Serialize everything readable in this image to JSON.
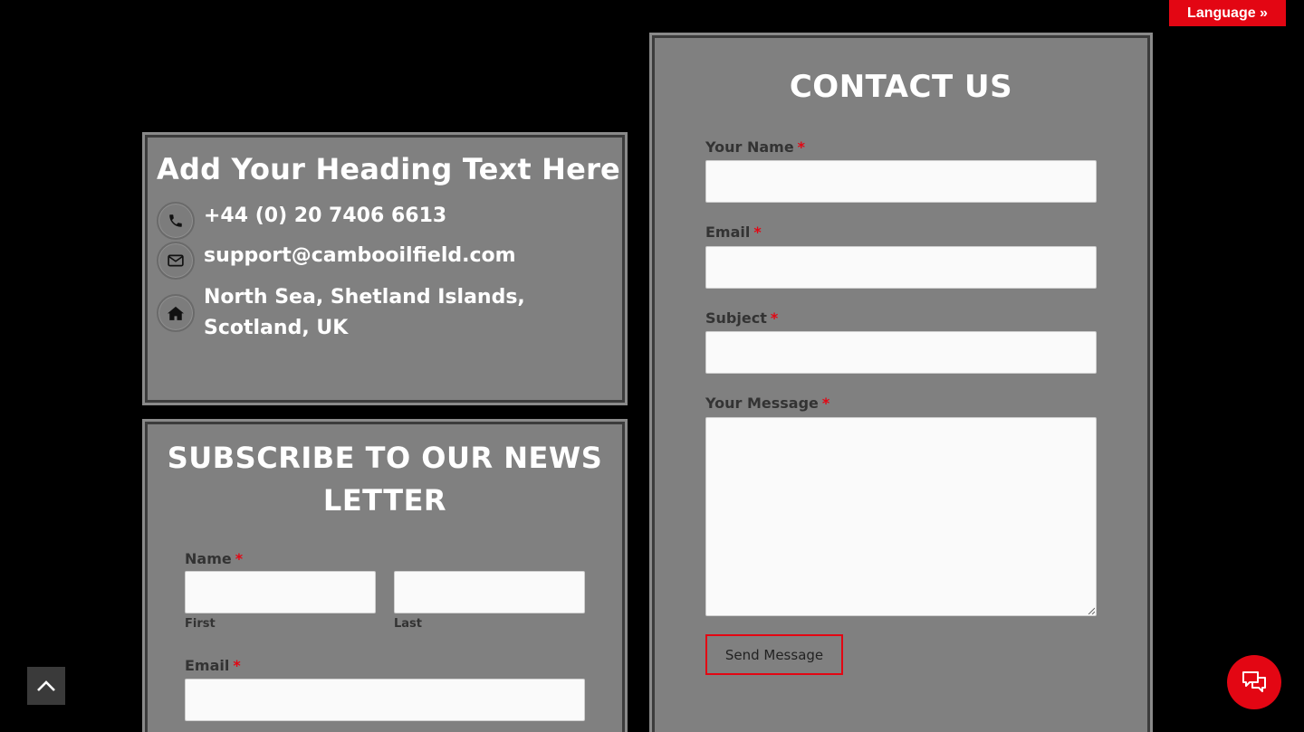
{
  "language_button": "Language »",
  "contact_info": {
    "heading": "Add Your Heading Text Here",
    "phone": "+44 (0) 20 7406 6613",
    "email": "support@cambooilfield.com",
    "address_line1": "North Sea, Shetland Islands,",
    "address_line2": "Scotland, UK"
  },
  "newsletter": {
    "heading_line1": "SUBSCRIBE TO OUR NEWS",
    "heading_line2": "LETTER",
    "name_label": "Name",
    "first_label": "First",
    "last_label": "Last",
    "email_label": "Email",
    "required_mark": "*"
  },
  "contact_form": {
    "heading": "CONTACT US",
    "name_label": "Your Name",
    "email_label": "Email",
    "subject_label": "Subject",
    "message_label": "Your Message",
    "required_mark": "*",
    "submit_label": "Send Message"
  },
  "colors": {
    "accent": "#e30613",
    "panel": "#808080",
    "background": "#000000"
  }
}
